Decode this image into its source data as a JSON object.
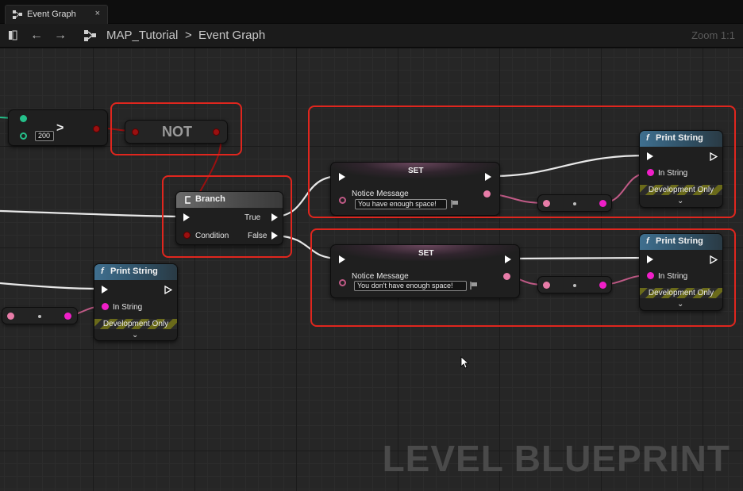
{
  "tab": {
    "label": "Event Graph",
    "close": "×",
    "icon": "graph-icon"
  },
  "toolbar": {
    "back_icon": "←",
    "forward_icon": "→",
    "breadcrumb_root": "MAP_Tutorial",
    "breadcrumb_sep": ">",
    "breadcrumb_current": "Event Graph",
    "zoom": "Zoom 1:1"
  },
  "nodes": {
    "compare": {
      "operator": ">",
      "value": "200"
    },
    "not": {
      "title": "NOT"
    },
    "branch": {
      "title": "Branch",
      "condition": "Condition",
      "true_label": "True",
      "false_label": "False"
    },
    "set_top": {
      "title": "SET",
      "var_label": "Notice Message",
      "value": "You have enough space!"
    },
    "set_bottom": {
      "title": "SET",
      "var_label": "Notice Message",
      "value": "You don't have enough space!"
    },
    "print_left": {
      "title": "Print String",
      "in_label": "In String",
      "dev": "Development Only"
    },
    "print_top": {
      "title": "Print String",
      "in_label": "In String",
      "dev": "Development Only"
    },
    "print_bottom": {
      "title": "Print String",
      "in_label": "In String",
      "dev": "Development Only"
    }
  },
  "colors": {
    "exec": "#ffffff",
    "string": "#f01fc8",
    "bool": "#9a1010",
    "int": "#25c08a",
    "highlight": "#e0261e"
  },
  "watermark": "LEVEL BLUEPRINT"
}
